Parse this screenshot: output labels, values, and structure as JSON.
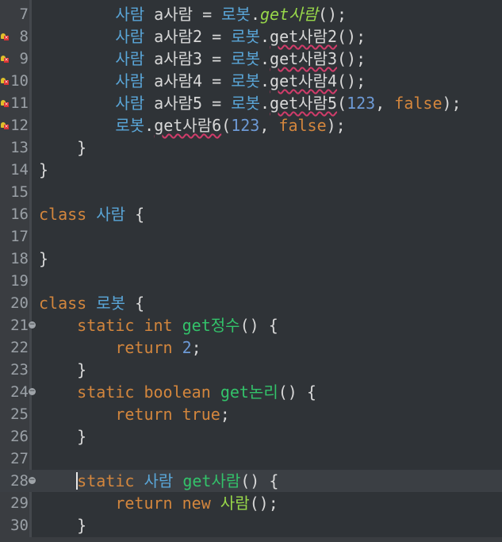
{
  "editor": {
    "lines": [
      {
        "num": "7",
        "indent": "        ",
        "tokens": [
          [
            "type",
            "사람"
          ],
          [
            "call",
            " a사람 = "
          ],
          [
            "type",
            "로봇"
          ],
          [
            "call",
            "."
          ],
          [
            "stat",
            "get사람"
          ],
          [
            "call",
            "();"
          ]
        ],
        "error": false,
        "fold": false
      },
      {
        "num": "8",
        "indent": "        ",
        "tokens": [
          [
            "type",
            "사람"
          ],
          [
            "call",
            " a사람2 = "
          ],
          [
            "type",
            "로봇"
          ],
          [
            "call",
            "."
          ],
          [
            "err",
            "get사람2"
          ],
          [
            "call",
            "();"
          ]
        ],
        "error": true,
        "fold": false
      },
      {
        "num": "9",
        "indent": "        ",
        "tokens": [
          [
            "type",
            "사람"
          ],
          [
            "call",
            " a사람3 = "
          ],
          [
            "type",
            "로봇"
          ],
          [
            "call",
            "."
          ],
          [
            "err",
            "get사람3"
          ],
          [
            "call",
            "();"
          ]
        ],
        "error": true,
        "fold": false
      },
      {
        "num": "10",
        "indent": "        ",
        "tokens": [
          [
            "type",
            "사람"
          ],
          [
            "call",
            " a사람4 = "
          ],
          [
            "type",
            "로봇"
          ],
          [
            "call",
            "."
          ],
          [
            "err",
            "get사람4"
          ],
          [
            "call",
            "();"
          ]
        ],
        "error": true,
        "fold": false
      },
      {
        "num": "11",
        "indent": "        ",
        "tokens": [
          [
            "type",
            "사람"
          ],
          [
            "call",
            " a사람5 = "
          ],
          [
            "type",
            "로봇"
          ],
          [
            "call",
            "."
          ],
          [
            "err",
            "get사람5"
          ],
          [
            "call",
            "("
          ],
          [
            "num",
            "123"
          ],
          [
            "call",
            ", "
          ],
          [
            "kw",
            "false"
          ],
          [
            "call",
            ");"
          ]
        ],
        "error": true,
        "fold": false
      },
      {
        "num": "12",
        "indent": "        ",
        "tokens": [
          [
            "type",
            "로봇"
          ],
          [
            "call",
            "."
          ],
          [
            "err",
            "get사람6"
          ],
          [
            "call",
            "("
          ],
          [
            "num",
            "123"
          ],
          [
            "call",
            ", "
          ],
          [
            "kw",
            "false"
          ],
          [
            "call",
            ");"
          ]
        ],
        "error": true,
        "fold": false
      },
      {
        "num": "13",
        "indent": "    ",
        "tokens": [
          [
            "call",
            "}"
          ]
        ],
        "error": false,
        "fold": false
      },
      {
        "num": "14",
        "indent": "",
        "tokens": [
          [
            "call",
            "}"
          ]
        ],
        "error": false,
        "fold": false
      },
      {
        "num": "15",
        "indent": "",
        "tokens": [],
        "error": false,
        "fold": false
      },
      {
        "num": "16",
        "indent": "",
        "tokens": [
          [
            "kw",
            "class"
          ],
          [
            "call",
            " "
          ],
          [
            "type",
            "사람"
          ],
          [
            "call",
            " {"
          ]
        ],
        "error": false,
        "fold": false
      },
      {
        "num": "17",
        "indent": "",
        "tokens": [],
        "error": false,
        "fold": false
      },
      {
        "num": "18",
        "indent": "",
        "tokens": [
          [
            "call",
            "}"
          ]
        ],
        "error": false,
        "fold": false
      },
      {
        "num": "19",
        "indent": "",
        "tokens": [],
        "error": false,
        "fold": false
      },
      {
        "num": "20",
        "indent": "",
        "tokens": [
          [
            "kw",
            "class"
          ],
          [
            "call",
            " "
          ],
          [
            "type",
            "로봇"
          ],
          [
            "call",
            " {"
          ]
        ],
        "error": false,
        "fold": false
      },
      {
        "num": "21",
        "indent": "    ",
        "tokens": [
          [
            "kw",
            "static"
          ],
          [
            "call",
            " "
          ],
          [
            "kw",
            "int"
          ],
          [
            "call",
            " "
          ],
          [
            "meth",
            "get정수"
          ],
          [
            "call",
            "() {"
          ]
        ],
        "error": false,
        "fold": true
      },
      {
        "num": "22",
        "indent": "        ",
        "tokens": [
          [
            "kw",
            "return"
          ],
          [
            "call",
            " "
          ],
          [
            "num",
            "2"
          ],
          [
            "call",
            ";"
          ]
        ],
        "error": false,
        "fold": false
      },
      {
        "num": "23",
        "indent": "    ",
        "tokens": [
          [
            "call",
            "}"
          ]
        ],
        "error": false,
        "fold": false
      },
      {
        "num": "24",
        "indent": "    ",
        "tokens": [
          [
            "kw",
            "static"
          ],
          [
            "call",
            " "
          ],
          [
            "kw",
            "boolean"
          ],
          [
            "call",
            " "
          ],
          [
            "meth",
            "get논리"
          ],
          [
            "call",
            "() {"
          ]
        ],
        "error": false,
        "fold": true
      },
      {
        "num": "25",
        "indent": "        ",
        "tokens": [
          [
            "kw",
            "return"
          ],
          [
            "call",
            " "
          ],
          [
            "kw",
            "true"
          ],
          [
            "call",
            ";"
          ]
        ],
        "error": false,
        "fold": false
      },
      {
        "num": "26",
        "indent": "    ",
        "tokens": [
          [
            "call",
            "}"
          ]
        ],
        "error": false,
        "fold": false
      },
      {
        "num": "27",
        "indent": "",
        "tokens": [],
        "error": false,
        "fold": false
      },
      {
        "num": "28",
        "indent": "    ",
        "tokens": [
          [
            "kw",
            "static"
          ],
          [
            "call",
            " "
          ],
          [
            "type",
            "사람"
          ],
          [
            "call",
            " "
          ],
          [
            "meth",
            "get사람"
          ],
          [
            "call",
            "() {"
          ]
        ],
        "error": false,
        "fold": true,
        "current": true
      },
      {
        "num": "29",
        "indent": "        ",
        "tokens": [
          [
            "kw",
            "return"
          ],
          [
            "call",
            " "
          ],
          [
            "kw",
            "new"
          ],
          [
            "call",
            " "
          ],
          [
            "stat2",
            "사람"
          ],
          [
            "call",
            "();"
          ]
        ],
        "error": false,
        "fold": false
      },
      {
        "num": "30",
        "indent": "    ",
        "tokens": [
          [
            "call",
            "}"
          ]
        ],
        "error": false,
        "fold": false
      }
    ],
    "colors": {
      "background": "#2f3337",
      "keyword": "#d3863d",
      "type": "#5aa6d8",
      "method": "#33c26a",
      "number": "#6d9ad6",
      "error_underline": "#d03c6a"
    }
  }
}
